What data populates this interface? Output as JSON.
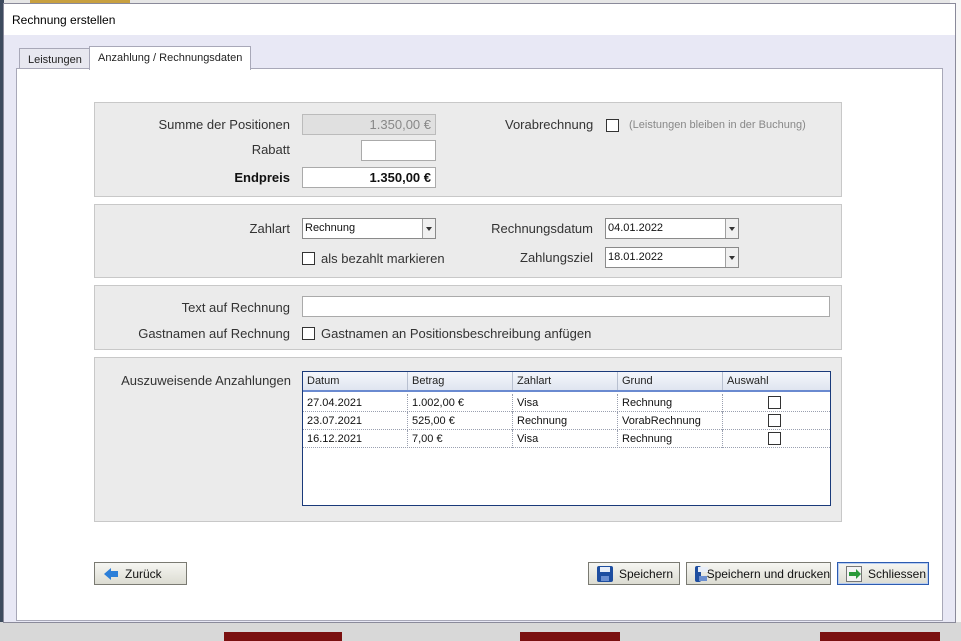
{
  "window": {
    "title": "Rechnung erstellen"
  },
  "tabs": [
    {
      "label": "Leistungen"
    },
    {
      "label": "Anzahlung / Rechnungsdaten"
    }
  ],
  "summary": {
    "sum_label": "Summe der Positionen",
    "sum_value": "1.350,00 €",
    "discount_label": "Rabatt",
    "discount_value": "",
    "total_label": "Endpreis",
    "total_value": "1.350,00 €",
    "prepayment_label": "Vorabrechnung",
    "prepayment_checked": false,
    "prepayment_hint": "(Leistungen bleiben in der Buchung)"
  },
  "payment": {
    "method_label": "Zahlart",
    "method_value": "Rechnung",
    "paid_label": "als bezahlt markieren",
    "paid_checked": false,
    "invoice_date_label": "Rechnungsdatum",
    "invoice_date_value": "04.01.2022",
    "due_label": "Zahlungsziel",
    "due_value": "18.01.2022"
  },
  "text": {
    "text_label": "Text auf Rechnung",
    "text_value": "",
    "guest_label": "Gastnamen auf Rechnung",
    "guest_option_label": "Gastnamen an Positionsbeschreibung anfügen",
    "guest_checked": false
  },
  "deposits": {
    "label": "Auszuweisende Anzahlungen",
    "columns": [
      "Datum",
      "Betrag",
      "Zahlart",
      "Grund",
      "Auswahl"
    ],
    "rows": [
      {
        "datum": "27.04.2021",
        "betrag": "1.002,00 €",
        "zahlart": "Visa",
        "grund": "Rechnung",
        "auswahl": false
      },
      {
        "datum": "23.07.2021",
        "betrag": "525,00 €",
        "zahlart": "Rechnung",
        "grund": "VorabRechnung",
        "auswahl": false
      },
      {
        "datum": "16.12.2021",
        "betrag": "7,00 €",
        "zahlart": "Visa",
        "grund": "Rechnung",
        "auswahl": false
      }
    ]
  },
  "buttons": {
    "back": "Zurück",
    "save": "Speichern",
    "save_print": "Speichern und drucken",
    "close": "Schliessen"
  },
  "colors": {
    "accent": "#2c5bb0",
    "grid_border": "#1a3a7a",
    "group_bg": "#ebebeb"
  },
  "icons": {
    "back": "arrow-left-icon",
    "save": "save-disk-icon",
    "save_print": "save-disk-icon",
    "close": "exit-icon"
  }
}
